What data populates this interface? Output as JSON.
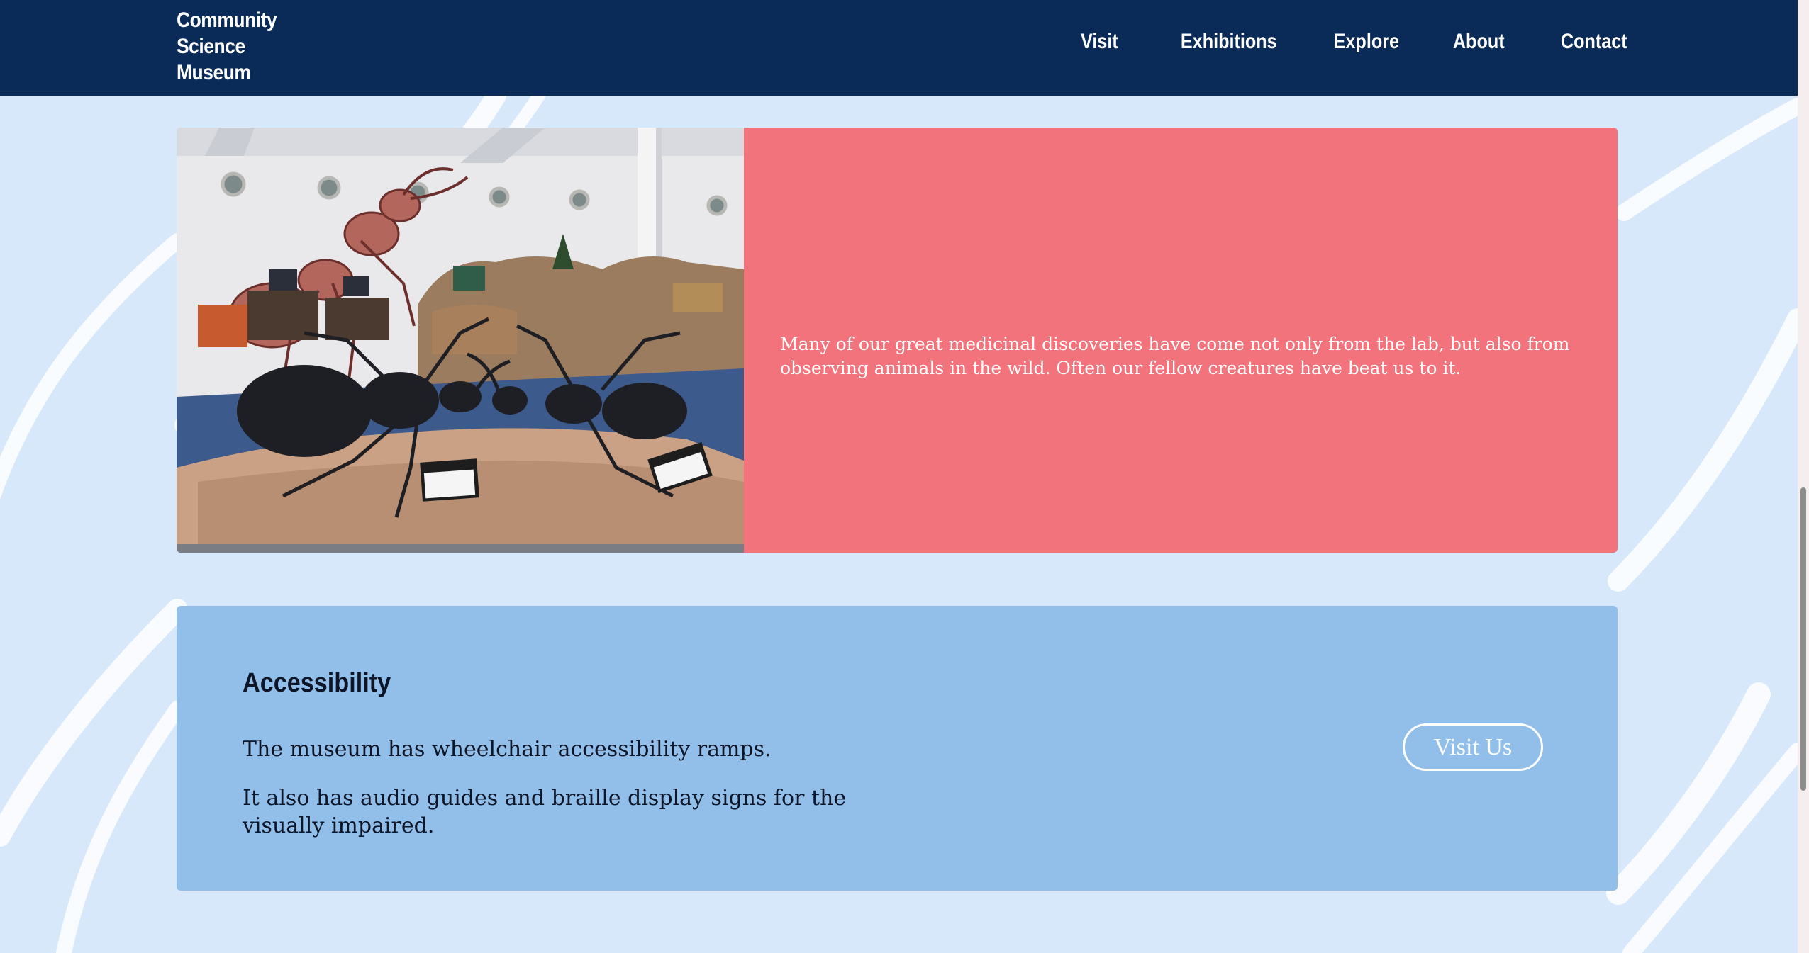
{
  "header": {
    "logo_lines": [
      "Community",
      "Science",
      "Museum"
    ],
    "nav": [
      "Visit",
      "Exhibitions",
      "Explore",
      "About",
      "Contact"
    ]
  },
  "feature": {
    "image_alt": "Giant ant sculptures exhibit",
    "text": "Many of our great medicinal discoveries have come not only from the lab, but also from observing animals in the wild. Often our fellow creatures have beat us to it."
  },
  "accessibility": {
    "title": "Accessibility",
    "paragraphs": [
      "The museum has wheelchair accessibility ramps.",
      "It also has audio guides and braille display signs for the visually impaired."
    ],
    "button_label": "Visit Us"
  },
  "colors": {
    "header_bg": "#0a2a57",
    "page_bg": "#d7e8fb",
    "feature_bg": "#f2737b",
    "accessibility_bg": "#91bfea"
  }
}
